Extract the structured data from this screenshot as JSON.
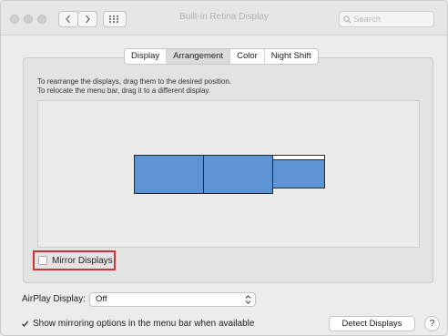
{
  "window": {
    "title": "Built-in Retina Display",
    "search": {
      "placeholder": "Search"
    }
  },
  "tabs": [
    {
      "label": "Display",
      "selected": false
    },
    {
      "label": "Arrangement",
      "selected": true
    },
    {
      "label": "Color",
      "selected": false
    },
    {
      "label": "Night Shift",
      "selected": false
    }
  ],
  "arrangement": {
    "instruction_1": "To rearrange the displays, drag them to the desired position.",
    "instruction_2": "To relocate the menu bar, drag it to a different display.",
    "display_color": "#5b93d3"
  },
  "mirror": {
    "label": "Mirror Displays",
    "checked": false,
    "highlight_color": "#c9343d"
  },
  "airplay": {
    "label": "AirPlay Display:",
    "value": "Off"
  },
  "show_mirroring": {
    "label": "Show mirroring options in the menu bar when available",
    "checked": true
  },
  "buttons": {
    "detect": "Detect Displays",
    "help": "?"
  }
}
